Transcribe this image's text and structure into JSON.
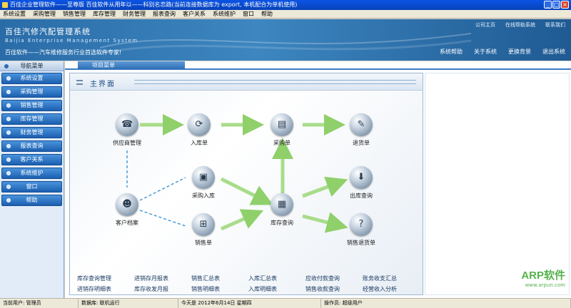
{
  "window": {
    "title": "百佳企业管理软件——至尊版   百佳软件从用年以——科别名恋路(当前连接数据库为 export, 本机配合为单机使用)",
    "buttons": [
      "_",
      "□",
      "×"
    ]
  },
  "menu": [
    "系统设置",
    "采购管理",
    "销售管理",
    "库存管理",
    "财务管理",
    "报表查询",
    "客户关系",
    "系统维护",
    "窗口",
    "帮助"
  ],
  "banner": {
    "title": "百佳汽修汽配管理系统",
    "subtitle": "Baijia Enterprise Management System",
    "slogan": "百佳软件——汽车维修服务行业首选软件专家!",
    "top_links": [
      "公司主页",
      "在线帮助系统",
      "联系我们"
    ],
    "buttons": [
      "系统帮助",
      "关于系统",
      "更换背景",
      "退出系统"
    ]
  },
  "sidebar": {
    "header": "导航菜单",
    "items": [
      "系统设置",
      "采购管理",
      "销售管理",
      "库存管理",
      "财务管理",
      "报表查询",
      "客户关系",
      "系统维护",
      "窗口",
      "帮助"
    ]
  },
  "main": {
    "tab": "项目菜单",
    "panel_title": "主界面",
    "nodes": [
      {
        "key": "supplier",
        "label": "供应商管理",
        "icon": "supplier-icon",
        "glyph": "☎"
      },
      {
        "key": "stock_in",
        "label": "入库单",
        "icon": "stock-in-icon",
        "glyph": "⟳"
      },
      {
        "key": "purchase_order",
        "label": "采购单",
        "icon": "purchase-order-icon",
        "glyph": "▤"
      },
      {
        "key": "return_order",
        "label": "退货单",
        "icon": "return-order-icon",
        "glyph": "✎"
      },
      {
        "key": "purchase_in",
        "label": "采购入库",
        "icon": "purchase-in-icon",
        "glyph": "▣"
      },
      {
        "key": "stock_out_query",
        "label": "出库查询",
        "icon": "stock-out-query-icon",
        "glyph": "⬇"
      },
      {
        "key": "customer",
        "label": "客户档案",
        "icon": "customer-icon",
        "glyph": "☻"
      },
      {
        "key": "inventory_query",
        "label": "库存查询",
        "icon": "inventory-query-icon",
        "glyph": "▦"
      },
      {
        "key": "sales_order",
        "label": "销售单",
        "icon": "sales-order-icon",
        "glyph": "⊞"
      },
      {
        "key": "sales_return",
        "label": "销售退货单",
        "icon": "sales-return-icon",
        "glyph": "?"
      }
    ],
    "report_links": [
      "库存查询管理",
      "进销存月报表",
      "销售汇总表",
      "入库汇总表",
      "应收付款查询",
      "账务收支汇总",
      "进销存明细表",
      "库存收发月报",
      "销售明细表",
      "入库明细表",
      "销售收款查询",
      "经营收入分析"
    ]
  },
  "watermark": {
    "line1": "ARP软件",
    "line2": "www.arpun.com"
  },
  "status": [
    "当前用户: 管理员",
    "数据库: 联机运行",
    "今天是 2012年6月14日 星期四",
    "操作员: 超级用户"
  ]
}
